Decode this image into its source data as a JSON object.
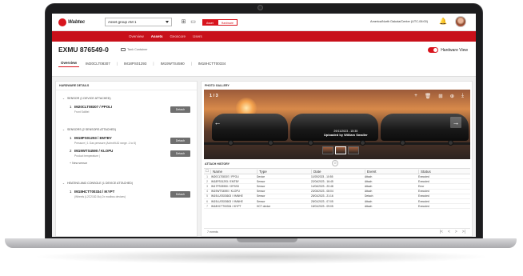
{
  "topbar": {
    "logo_text": "Wabtec",
    "asset_group": "Asset group AM 1",
    "toggle_asset": "Asset",
    "toggle_hardware": "Hardware",
    "timezone": "America/North Dakota/Center (UTC-06:00)"
  },
  "nav": {
    "items": [
      "Overview",
      "Assets",
      "Geoscore",
      "Users"
    ],
    "active": "Assets"
  },
  "asset": {
    "title": "EXMU 876549-0",
    "type": "Tank Container",
    "hardware_view": "Hardware View",
    "tabs": [
      "Overview",
      "IM20CLT08307",
      "IM18PS01293",
      "IM19WTS4590",
      "IM18HCTT00334"
    ]
  },
  "hardware_details": {
    "heading": "HARDWARE DETAILS",
    "sections": [
      {
        "label": "SENSOR (1 DEVICE ATTACHED)",
        "devices": [
          {
            "index": "1",
            "name": "IM20CLT08307 / PPOLI",
            "sub": "Front Sollitel",
            "action": "Detach"
          }
        ]
      },
      {
        "label": "SENSORS (2 SENSORS ATTACHED)",
        "devices": [
          {
            "index": "1",
            "name": "IM18PS01293 / EMTBY",
            "sub": "Pressure | 1 Gas pressure (Achrofit A2 range -1 to 6)",
            "action": "Detach"
          },
          {
            "index": "2",
            "name": "IM19WTS4590 / KLOPU",
            "sub": "Product temperature |",
            "action": "Detach"
          }
        ],
        "new_label": "New sensor"
      },
      {
        "label": "HEATING AND CONSOLE (1 DEVICE ATTACHED)",
        "devices": [
          {
            "index": "1",
            "name": "IM18HCTT00334 / IKYPT",
            "sub": "(Wheels (L2C2182-Bu) 2x modbus devices)",
            "action": "Detach"
          }
        ]
      }
    ]
  },
  "gallery": {
    "heading": "PHOTO GALLERY",
    "counter": "1 / 3",
    "date": "29/11/2023 - 15:35",
    "uploader": "Uploaded by William Smaller"
  },
  "attach_history": {
    "heading": "ATTACH HISTORY",
    "columns": [
      "Name",
      "Type",
      "Date",
      "Event",
      "Status"
    ],
    "rows": [
      {
        "n": "1",
        "name": "IM20CLT08307 / PPOLI",
        "type": "Device",
        "date": "11/05/2023 - 10:55",
        "event": "Attach",
        "status": "Executed"
      },
      {
        "n": "2",
        "name": "IM18PS01293 / EMTBY",
        "type": "Sensor",
        "date": "22/04/2023 - 16:45",
        "event": "Attach",
        "status": "Executed"
      },
      {
        "n": "3",
        "name": "IM17PS03950 / GFSSD",
        "type": "Sensor",
        "date": "14/04/2023 - 20:48",
        "event": "Attach",
        "status": "Error"
      },
      {
        "n": "4",
        "name": "IM19WTS4590 / KLOPU",
        "type": "Sensor",
        "date": "23/03/2023 - 08:04",
        "event": "Attach",
        "status": "Executed"
      },
      {
        "n": "5",
        "name": "IM19LUSS03603 / VMNHE",
        "type": "Sensor",
        "date": "25/01/2023 - 21:16",
        "event": "Detach",
        "status": "Executed"
      },
      {
        "n": "6",
        "name": "IM19LUSS03603 / VMNHE",
        "type": "Sensor",
        "date": "25/01/2023 - 07:05",
        "event": "Attach",
        "status": "Executed"
      },
      {
        "n": "7",
        "name": "IM18HCTT00334 / IKYPT",
        "type": "HCT device",
        "date": "15/01/2023 - 09:05",
        "event": "Attach",
        "status": "Executed"
      }
    ],
    "count_label": "7 events"
  }
}
